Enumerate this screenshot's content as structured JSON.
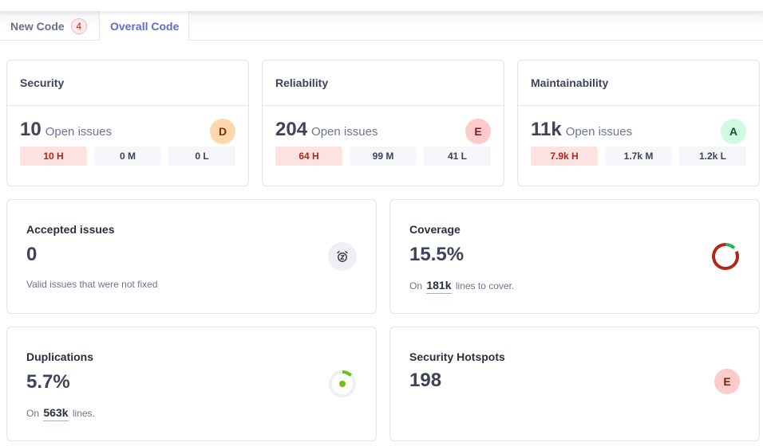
{
  "tabs": [
    {
      "label": "New Code",
      "badge": "4",
      "active": false
    },
    {
      "label": "Overall Code",
      "active": true
    }
  ],
  "summary_cards": [
    {
      "title": "Security",
      "count": "10",
      "count_label": "Open issues",
      "grade": "D",
      "severities": [
        {
          "label": "10 H",
          "level": "high"
        },
        {
          "label": "0 M",
          "level": "medium"
        },
        {
          "label": "0 L",
          "level": "low"
        }
      ]
    },
    {
      "title": "Reliability",
      "count": "204",
      "count_label": "Open issues",
      "grade": "E",
      "severities": [
        {
          "label": "64 H",
          "level": "high"
        },
        {
          "label": "99 M",
          "level": "medium"
        },
        {
          "label": "41 L",
          "level": "low"
        }
      ]
    },
    {
      "title": "Maintainability",
      "count": "11k",
      "count_label": "Open issues",
      "grade": "A",
      "severities": [
        {
          "label": "7.9k H",
          "level": "high"
        },
        {
          "label": "1.7k M",
          "level": "medium"
        },
        {
          "label": "1.2k L",
          "level": "low"
        }
      ]
    }
  ],
  "accepted_issues": {
    "title": "Accepted issues",
    "value": "0",
    "description": "Valid issues that were not fixed",
    "icon": "snooze-alarm-icon"
  },
  "coverage": {
    "title": "Coverage",
    "value": "15.5%",
    "percent": 15.5,
    "sub_prefix": "On",
    "sub_value": "181k",
    "sub_suffix": "lines to cover.",
    "colors": {
      "covered": "#22b35e",
      "uncovered": "#b3261e"
    }
  },
  "duplications": {
    "title": "Duplications",
    "value": "5.7%",
    "percent": 5.7,
    "sub_prefix": "On",
    "sub_value": "563k",
    "sub_suffix": "lines.",
    "colors": {
      "filled": "#6cbf1b",
      "track": "#eef0f6"
    }
  },
  "security_hotspots": {
    "title": "Security Hotspots",
    "value": "198",
    "grade": "E"
  }
}
